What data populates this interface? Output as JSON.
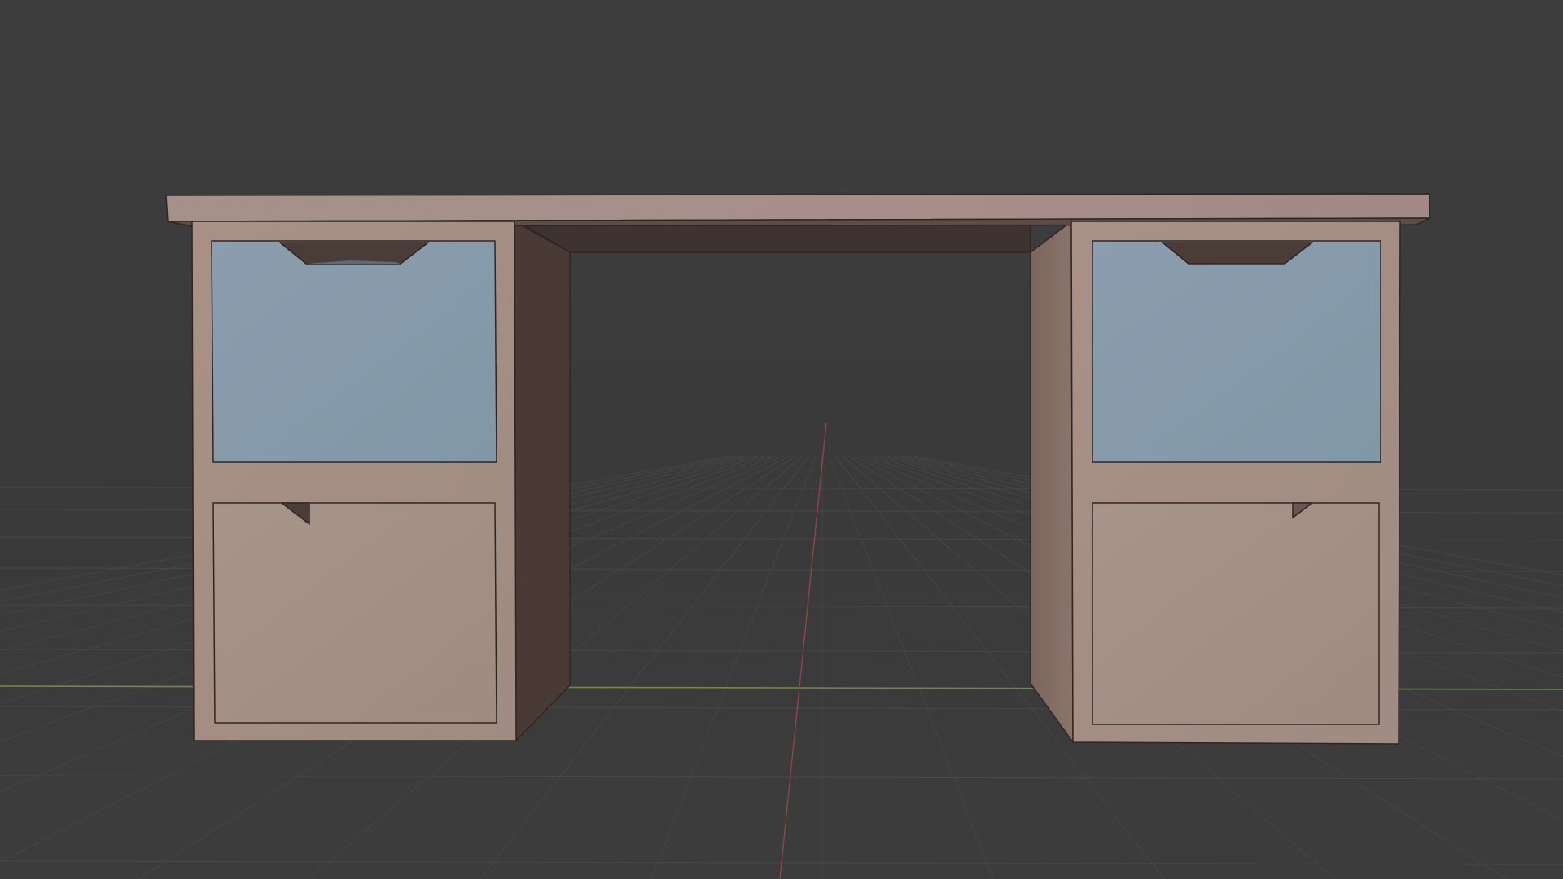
{
  "viewport": {
    "background_color": "#3d3d3d",
    "horizon_color": "#393939",
    "grid_line_color": "#4a4a4a",
    "x_axis_color": "#6f8f46",
    "y_axis_color": "#9a4848"
  },
  "scene": {
    "object": "desk",
    "materials": {
      "wood_light": "#a48f85",
      "wood_top": "#a88f8a",
      "wood_shadow": "#483834",
      "wood_side": "#7c6860",
      "glass": "#8499aa",
      "handle": "#4c3c38"
    }
  }
}
